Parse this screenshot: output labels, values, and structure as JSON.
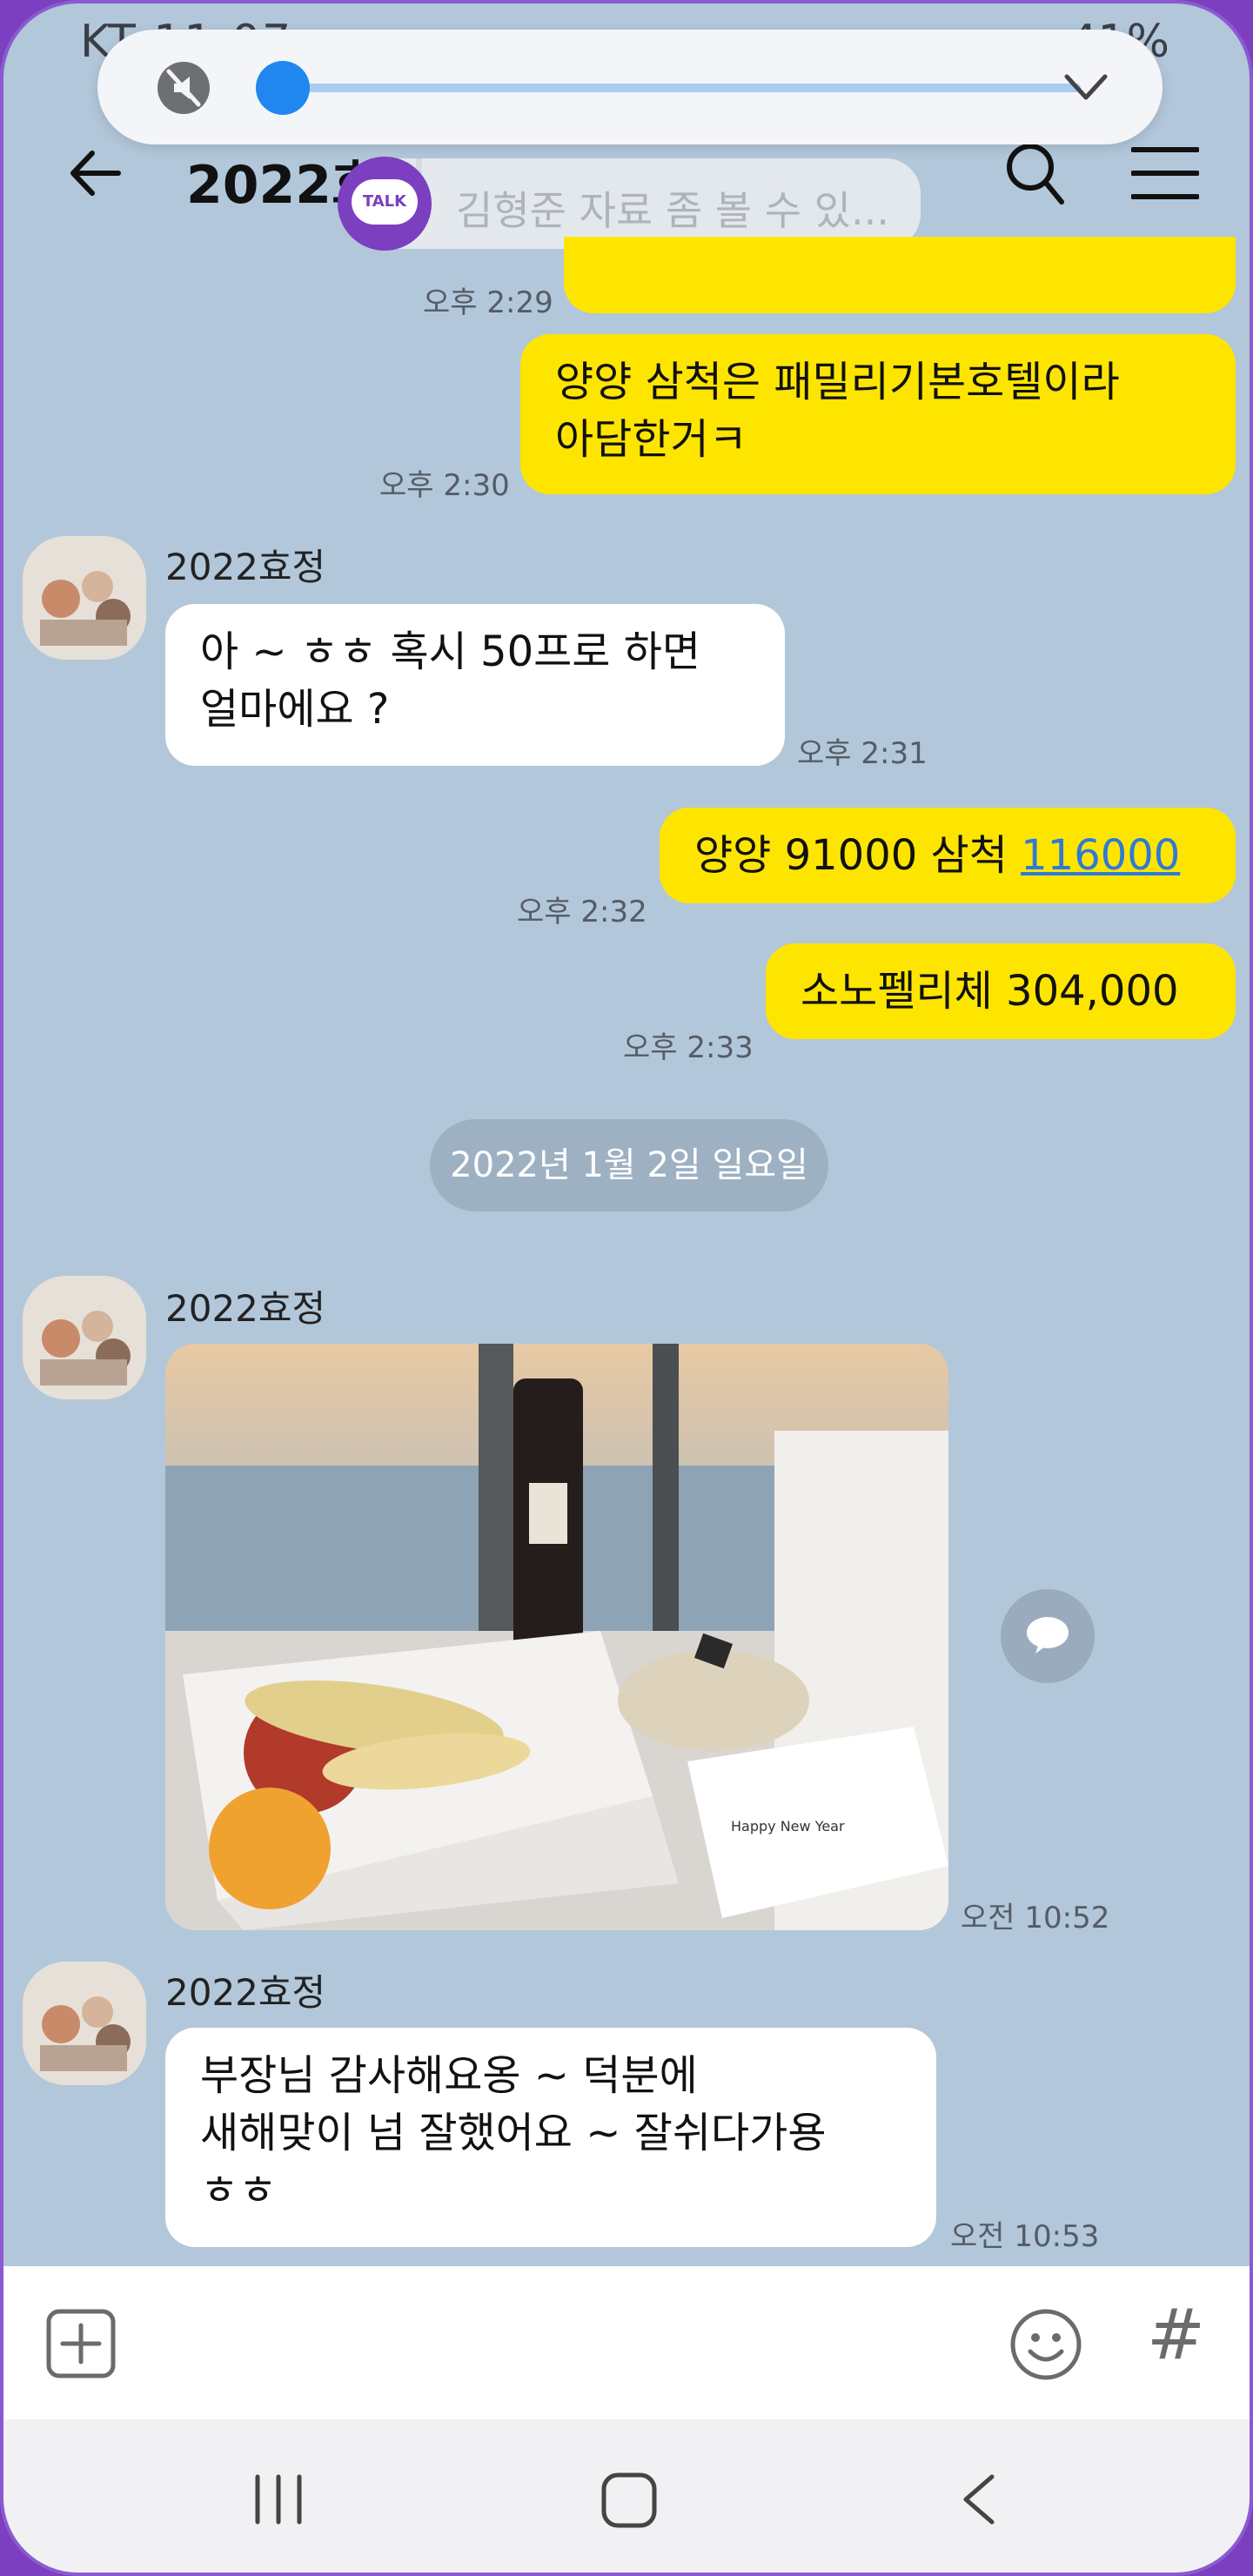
{
  "status_bar": {
    "carrier_time": "KT 11:07",
    "battery": "41%"
  },
  "volume_panel": {
    "level": 0.0
  },
  "header": {
    "title": "2022효정"
  },
  "notification": {
    "app_label": "TALK",
    "text": "김형준   자료 좀 볼 수 있..."
  },
  "messages": [
    {
      "side": "right",
      "text": "... ",
      "time": "오후 2:29"
    },
    {
      "side": "right",
      "text_line1": "양양 삼척은 패밀리기본호텔이라",
      "text_line2": "아담한거ㅋ",
      "time": "오후 2:30"
    },
    {
      "side": "left",
      "sender": "2022효정",
      "text_line1": "아 ~ ㅎㅎ 혹시 50프로 하면",
      "text_line2": "얼마에요 ?",
      "time": "오후 2:31"
    },
    {
      "side": "right",
      "text_prefix": "양양 91000 삼척 ",
      "text_link": "116000",
      "time": "오후 2:32"
    },
    {
      "side": "right",
      "text": "소노펠리체 304,000",
      "time": "오후 2:33"
    }
  ],
  "date_divider": "2022년 1월 2일 일요일",
  "photo_message": {
    "sender": "2022효정",
    "time": "오전 10:52",
    "card_text": "Happy New Year"
  },
  "last_message": {
    "sender": "2022효정",
    "line1": "부장님 감사해요옹 ~ 덕분에",
    "line2": "새해맞이 넘 잘했어요 ~ 잘쉬다가용",
    "line3": "ㅎㅎ",
    "time": "오전 10:53"
  },
  "input_bar": {
    "hash": "#"
  }
}
